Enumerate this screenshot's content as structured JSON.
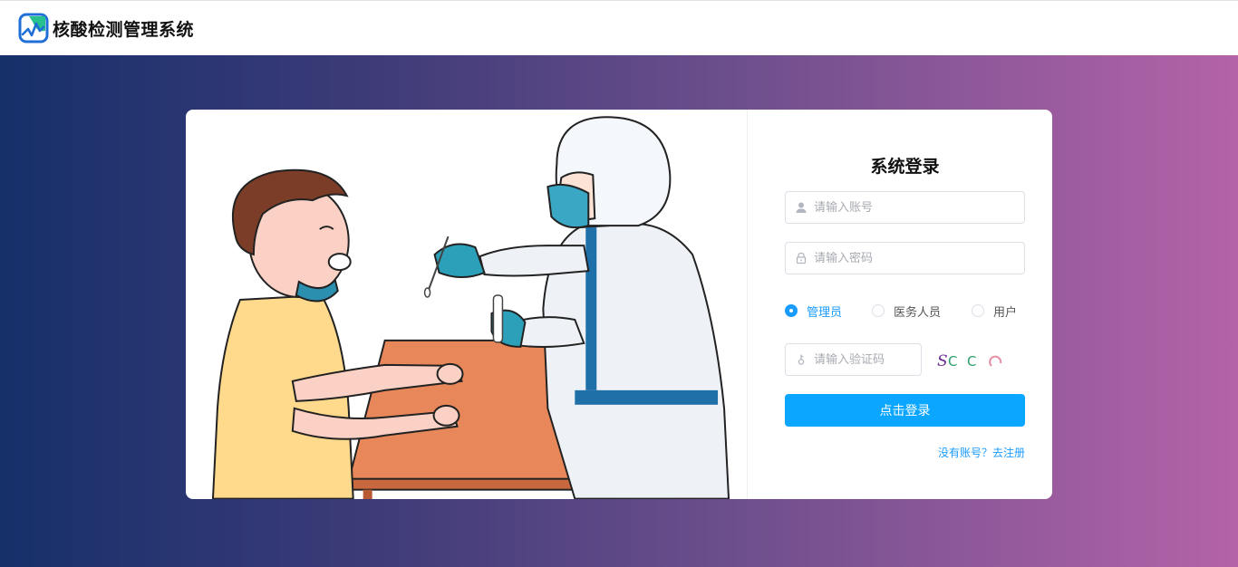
{
  "header": {
    "app_title": "核酸检测管理系统"
  },
  "login": {
    "title": "系统登录",
    "account_placeholder": "请输入账号",
    "password_placeholder": "请输入密码",
    "captcha_placeholder": "请输入验证码",
    "roles": [
      {
        "label": "管理员",
        "checked": true
      },
      {
        "label": "医务人员",
        "checked": false
      },
      {
        "label": "用户",
        "checked": false
      }
    ],
    "captcha_chars": "SC C",
    "submit_label": "点击登录",
    "register_link": "没有账号？去注册"
  },
  "colors": {
    "accent": "#0aa6ff",
    "gradient_start": "#16306a",
    "gradient_end": "#b463a8"
  }
}
